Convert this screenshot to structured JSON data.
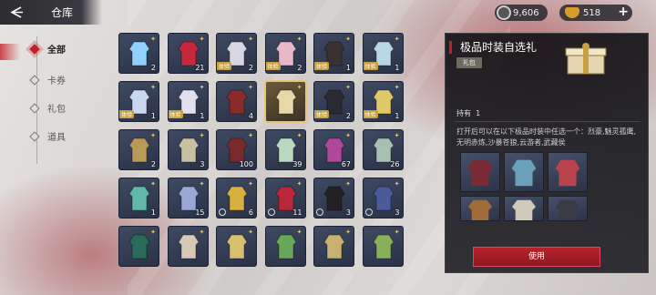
{
  "header": {
    "title": "仓库"
  },
  "currencies": [
    {
      "name": "silver",
      "value": "9,606"
    },
    {
      "name": "gold",
      "value": "518"
    }
  ],
  "sidebar": {
    "items": [
      {
        "label": "全部",
        "active": true
      },
      {
        "label": "卡券"
      },
      {
        "label": "礼包"
      },
      {
        "label": "道具"
      }
    ]
  },
  "grid": {
    "items": [
      {
        "count": "2",
        "tag": ""
      },
      {
        "count": "21",
        "tag": ""
      },
      {
        "count": "2",
        "tag": "体验"
      },
      {
        "count": "2",
        "tag": "体验"
      },
      {
        "count": "1",
        "tag": "体验"
      },
      {
        "count": "1",
        "tag": "体验"
      },
      {
        "count": "1",
        "tag": "体验"
      },
      {
        "count": "1",
        "tag": "体验"
      },
      {
        "count": "4",
        "tag": ""
      },
      {
        "count": "",
        "tag": ""
      },
      {
        "count": "2",
        "tag": "体验"
      },
      {
        "count": "1",
        "tag": "体验"
      },
      {
        "count": "2",
        "tag": ""
      },
      {
        "count": "3",
        "tag": ""
      },
      {
        "count": "100",
        "tag": ""
      },
      {
        "count": "39",
        "tag": ""
      },
      {
        "count": "67",
        "tag": ""
      },
      {
        "count": "26",
        "tag": ""
      },
      {
        "count": "1",
        "tag": ""
      },
      {
        "count": "15",
        "tag": ""
      },
      {
        "count": "6",
        "tag": ""
      },
      {
        "count": "11",
        "tag": ""
      },
      {
        "count": "3",
        "tag": ""
      },
      {
        "count": "3",
        "tag": ""
      },
      {
        "count": "",
        "tag": ""
      },
      {
        "count": "",
        "tag": ""
      },
      {
        "count": "",
        "tag": ""
      },
      {
        "count": "",
        "tag": ""
      },
      {
        "count": "",
        "tag": ""
      },
      {
        "count": "",
        "tag": ""
      }
    ]
  },
  "detail": {
    "title": "极品时装自选礼",
    "badge": "礼包",
    "own_label": "持有",
    "own_value": "1",
    "description": "打开后可以在以下极品时装中任选一个：烈豪,魅灵孤鹰,无明赤炼,沙暴苍狼,云游者,武藏侯",
    "use_label": "使用"
  }
}
